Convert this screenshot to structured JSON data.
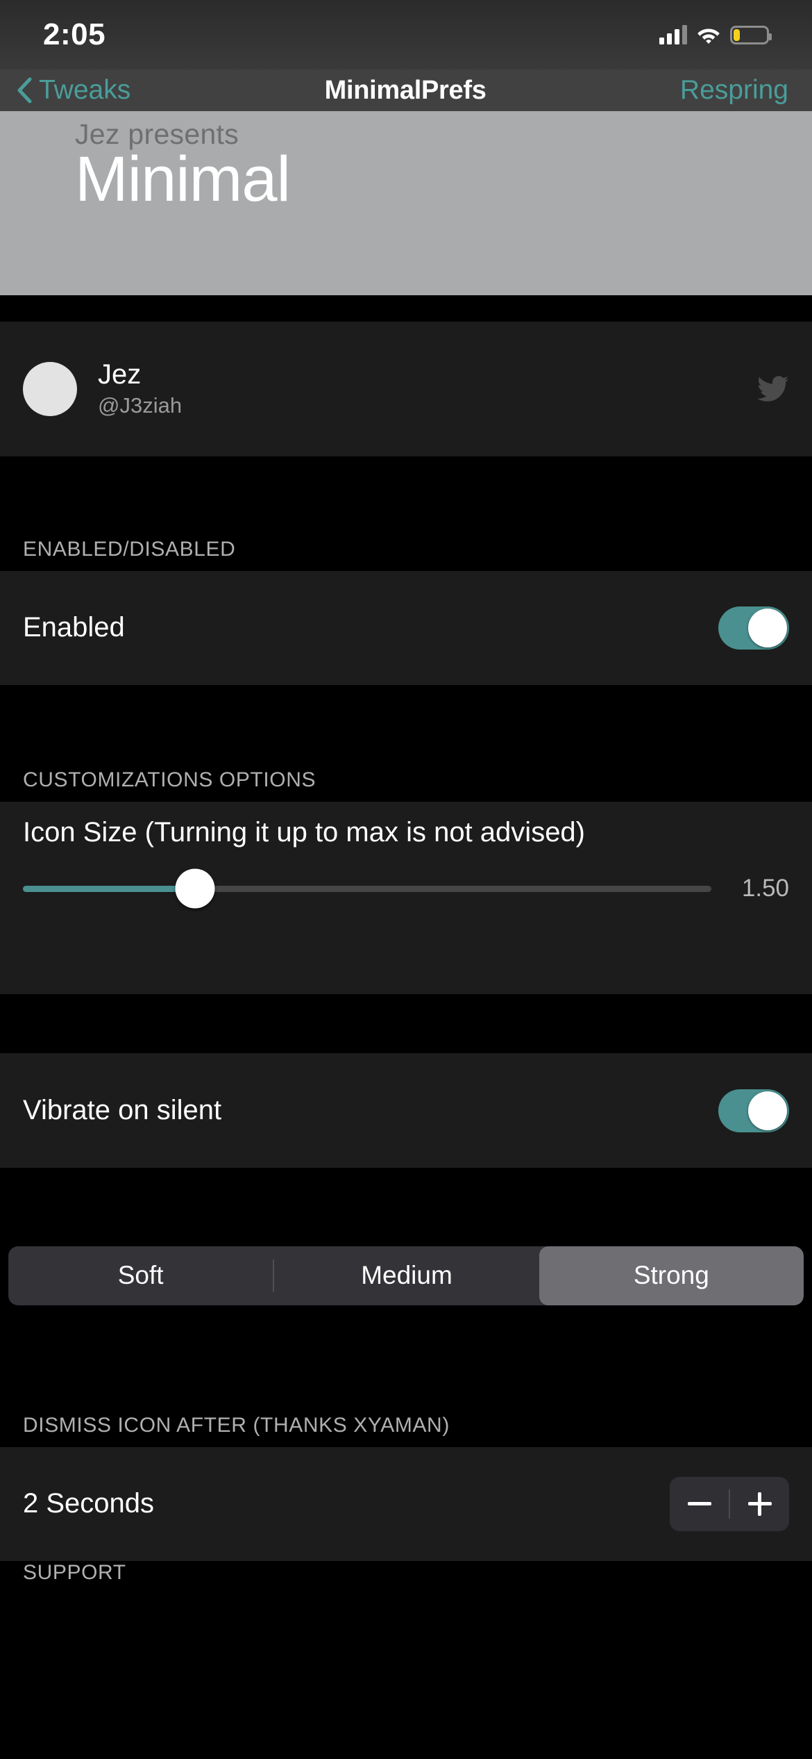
{
  "status_bar": {
    "time": "2:05",
    "cellular_icon": "cellular-bars-icon",
    "wifi_icon": "wifi-icon",
    "battery_icon": "battery-low-icon",
    "battery_level_percent": 20,
    "battery_color": "#f5d11e"
  },
  "nav_bar": {
    "back_label": "Tweaks",
    "back_icon": "chevron-left-icon",
    "title": "MinimalPrefs",
    "action_label": "Respring",
    "tint_color": "#4a9d9a",
    "background_color": "#414141"
  },
  "banner": {
    "subtitle": "Jez presents",
    "title": "Minimal",
    "background_color": "#a9abad",
    "title_color": "#ffffff",
    "subtitle_color": "#6d6f71"
  },
  "author": {
    "avatar_icon": "avatar-placeholder-icon",
    "name": "Jez",
    "handle": "@J3ziah",
    "social_icon": "twitter-bird-icon"
  },
  "sections": [
    {
      "header": "ENABLED/DISABLED",
      "rows": [
        {
          "label": "Enabled",
          "type": "toggle",
          "value": "on"
        }
      ]
    },
    {
      "header": "CUSTOMIZATIONS OPTIONS",
      "rows": [
        {
          "label": "Icon Size (Turning it up to max is not advised)",
          "type": "slider",
          "value_text": "1.50",
          "fill_percent": 25,
          "track_color": "#464646",
          "fill_color": "#4a9090"
        },
        {
          "label": "Vibrate on silent",
          "type": "toggle",
          "value": "on"
        },
        {
          "type": "segmented",
          "options": [
            "Soft",
            "Medium",
            "Strong"
          ],
          "selected": "Strong"
        }
      ]
    },
    {
      "header": "DISMISS ICON AFTER (THANKS XYAMAN)",
      "rows": [
        {
          "label": "2 Seconds",
          "type": "stepper",
          "decrement_icon": "minus-icon",
          "increment_icon": "plus-icon"
        }
      ]
    }
  ],
  "cut_off_header": "SUPPORT",
  "toggle_on_color": "#4a9090",
  "cell_background": "#1c1c1c",
  "page_background": "#000000"
}
